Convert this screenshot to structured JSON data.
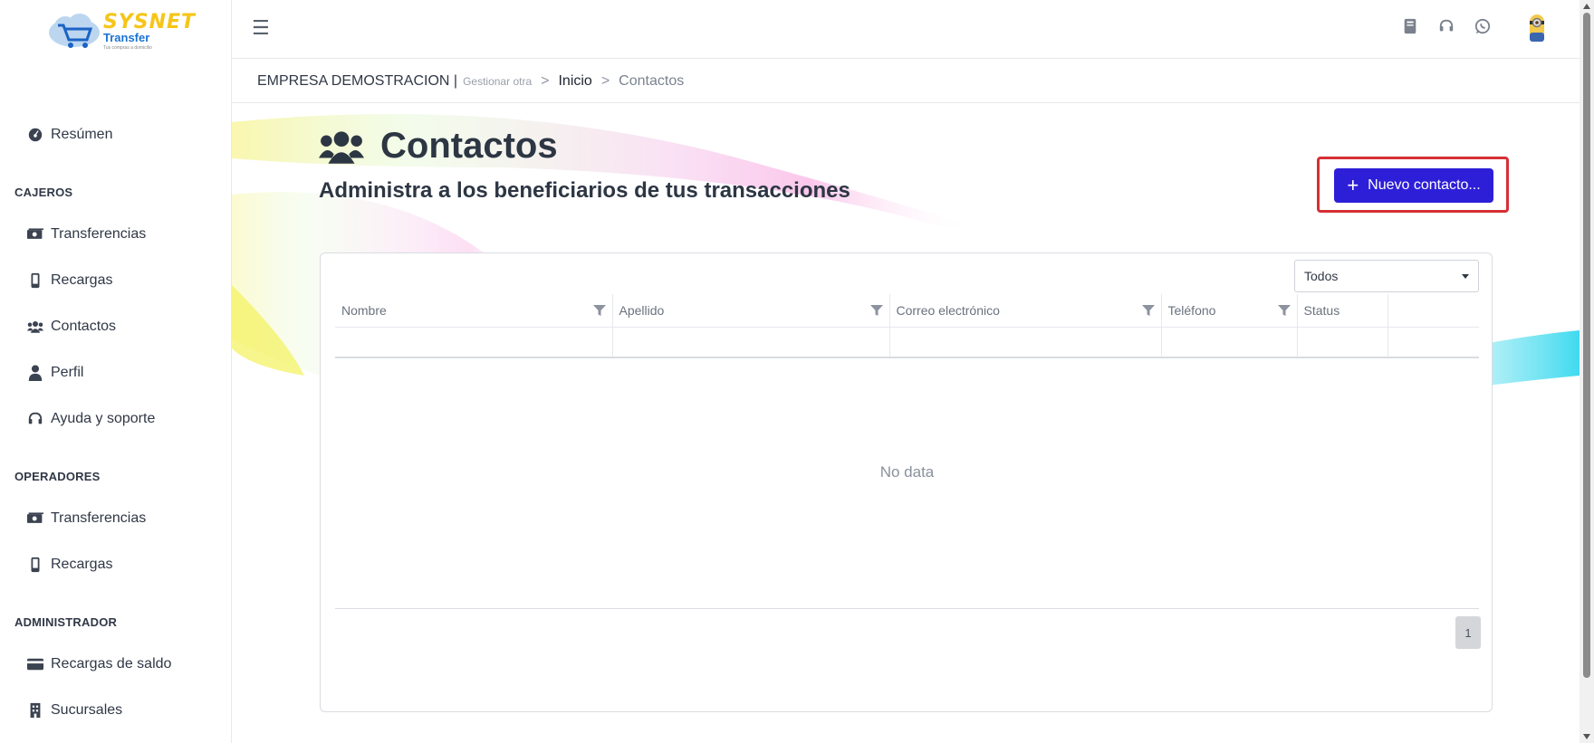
{
  "colors": {
    "primary": "#2d1fd8",
    "highlight": "#d62f35",
    "text": "#303846"
  },
  "logo": {
    "brand": "SYSNET",
    "product": "Transfer",
    "tagline": "Tus compras a domicilio"
  },
  "sidebar": {
    "summary": {
      "label": "Resúmen",
      "icon": "dashboard-icon"
    },
    "sections": [
      {
        "title": "CAJEROS",
        "items": [
          {
            "label": "Transferencias",
            "icon": "money-icon"
          },
          {
            "label": "Recargas",
            "icon": "mobile-icon"
          },
          {
            "label": "Contactos",
            "icon": "users-icon"
          },
          {
            "label": "Perfil",
            "icon": "user-icon"
          },
          {
            "label": "Ayuda y soporte",
            "icon": "headset-icon"
          }
        ]
      },
      {
        "title": "OPERADORES",
        "items": [
          {
            "label": "Transferencias",
            "icon": "money-icon"
          },
          {
            "label": "Recargas",
            "icon": "mobile-icon"
          }
        ]
      },
      {
        "title": "ADMINISTRADOR",
        "items": [
          {
            "label": "Recargas de saldo",
            "icon": "credit-card-icon"
          },
          {
            "label": "Sucursales",
            "icon": "building-icon"
          }
        ]
      }
    ]
  },
  "topbar": {
    "menu_icon": "hamburger-icon",
    "icons": [
      "book-icon",
      "headset-icon",
      "whatsapp-icon"
    ],
    "avatar": "minion-avatar"
  },
  "breadcrumb": {
    "company": "EMPRESA DEMOSTRACION |",
    "manage": "Gestionar otra",
    "sep": ">",
    "home": "Inicio",
    "current": "Contactos"
  },
  "page": {
    "title": "Contactos",
    "subtitle": "Administra a los beneficiarios de tus transacciones",
    "new_button": "Nuevo contacto..."
  },
  "table": {
    "filter_value": "Todos",
    "columns": [
      "Nombre",
      "Apellido",
      "Correo electrónico",
      "Teléfono",
      "Status",
      ""
    ],
    "empty_text": "No data",
    "current_page": "1"
  }
}
